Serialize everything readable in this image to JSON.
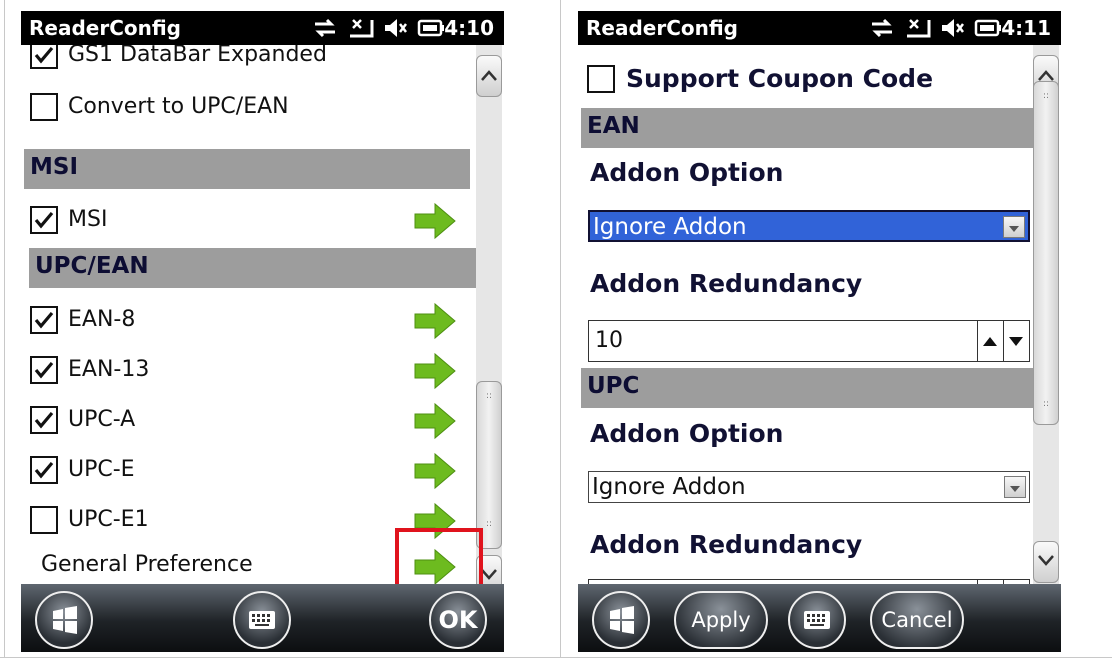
{
  "left_panel": {
    "title": "ReaderConfig",
    "time": "4:10",
    "items": {
      "gs1_databar_expanded": {
        "label": "GS1 DataBar Expanded",
        "checked": true
      },
      "convert_upc_ean": {
        "label": "Convert to UPC/EAN",
        "checked": false
      },
      "msi_section": "MSI",
      "msi": {
        "label": "MSI",
        "checked": true
      },
      "upcean_section": "UPC/EAN",
      "ean8": {
        "label": "EAN-8",
        "checked": true
      },
      "ean13": {
        "label": "EAN-13",
        "checked": true
      },
      "upca": {
        "label": "UPC-A",
        "checked": true
      },
      "upce": {
        "label": "UPC-E",
        "checked": true
      },
      "upce1": {
        "label": "UPC-E1",
        "checked": false
      },
      "general_preference": "General Preference"
    },
    "ok_label": "OK"
  },
  "right_panel": {
    "title": "ReaderConfig",
    "time": "4:11",
    "support_coupon": {
      "label": "Support Coupon Code",
      "checked": false
    },
    "ean_section": "EAN",
    "ean_addon_option_label": "Addon Option",
    "ean_addon_option_value": "Ignore Addon",
    "ean_addon_redundancy_label": "Addon Redundancy",
    "ean_addon_redundancy_value": "10",
    "upc_section": "UPC",
    "upc_addon_option_label": "Addon Option",
    "upc_addon_option_value": "Ignore Addon",
    "upc_addon_redundancy_label": "Addon Redundancy",
    "apply_label": "Apply",
    "cancel_label": "Cancel"
  },
  "colors": {
    "highlight": "#e0131d",
    "arrow_green": "#6dbb1f",
    "section_bg": "#9d9d9d",
    "selection_blue": "#3163d8"
  }
}
